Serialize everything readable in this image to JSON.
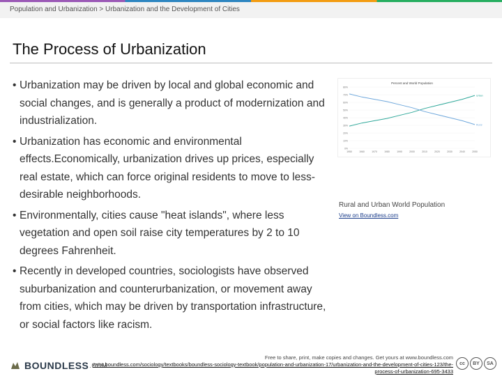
{
  "breadcrumb": "Population and Urbanization > Urbanization and the Development of Cities",
  "title": "The Process of Urbanization",
  "bullets": [
    "Urbanization may be driven by local and global economic and social changes, and is generally a product of modernization and industrialization.",
    "Urbanization has economic and environmental effects.Economically, urbanization drives up prices, especially real estate, which can force original residents to move to less-desirable neighborhoods.",
    "Environmentally, cities cause \"heat islands\", where less vegetation and open soil raise city temperatures by 2 to 10 degrees Fahrenheit.",
    "Recently in developed countries, sociologists have observed suburbanization and counterurbanization, or movement away from cities, which may be driven by transportation infrastructure, or social factors like racism."
  ],
  "bullet_glyph": "•",
  "figure": {
    "caption": "Rural and Urban World Population",
    "link": "View on Boundless.com"
  },
  "chart_data": {
    "type": "line",
    "title": "Percent and World Population",
    "x": [
      1950,
      1960,
      1970,
      1980,
      1990,
      2000,
      2010,
      2020,
      2030,
      2040,
      2050
    ],
    "series": [
      {
        "name": "Urban",
        "color": "#2fa89a",
        "values": [
          29,
          33,
          36,
          39,
          43,
          47,
          52,
          56,
          60,
          64,
          69
        ]
      },
      {
        "name": "Rural",
        "color": "#6fa8dc",
        "values": [
          71,
          67,
          64,
          61,
          57,
          53,
          48,
          44,
          40,
          36,
          31
        ]
      }
    ],
    "ylim": [
      0,
      80
    ],
    "yticks": [
      "80%",
      "70%",
      "60%",
      "50%",
      "40%",
      "30%",
      "20%",
      "10%",
      "0%"
    ]
  },
  "footer": {
    "logo_text": "BOUNDLESS",
    "logo_tld": ".COM",
    "notice": "Free to share, print, make copies and changes. Get yours at www.boundless.com",
    "url": "www.boundless.com/sociology/textbooks/boundless-sociology-textbook/population-and-urbanization-17/urbanization-and-the-development-of-cities-123/the-process-of-urbanization-695-3433",
    "cc_badges": [
      "cc",
      "BY",
      "SA"
    ]
  }
}
